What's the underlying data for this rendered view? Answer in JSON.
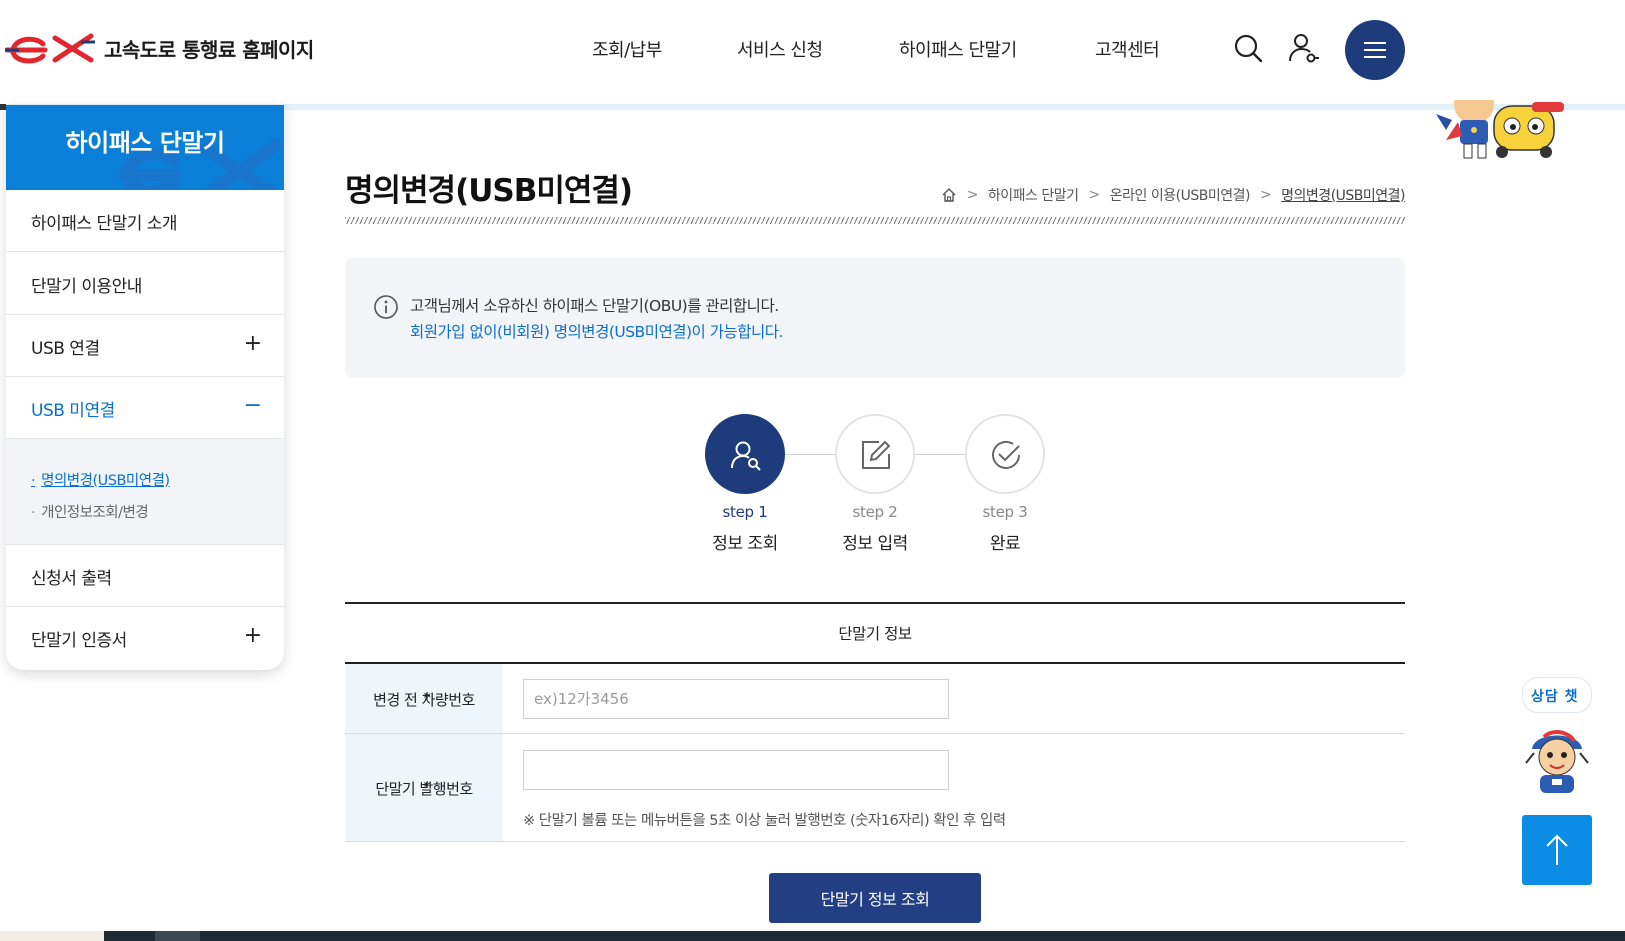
{
  "header": {
    "logo_text": "고속도로 통행료 홈페이지",
    "nav": [
      "조회/납부",
      "서비스 신청",
      "하이패스 단말기",
      "고객센터"
    ]
  },
  "sidebar": {
    "title": "하이패스 단말기",
    "items": [
      {
        "label": "하이패스 단말기 소개",
        "toggle": ""
      },
      {
        "label": "단말기 이용안내",
        "toggle": ""
      },
      {
        "label": "USB 연결",
        "toggle": "+"
      },
      {
        "label": "USB 미연결",
        "toggle": "−"
      },
      {
        "label": "신청서 출력",
        "toggle": ""
      },
      {
        "label": "단말기 인증서",
        "toggle": "+"
      }
    ],
    "sub_items": [
      "명의변경(USB미연결)",
      "개인정보조회/변경"
    ]
  },
  "page": {
    "title": "명의변경(USB미연결)",
    "breadcrumb": [
      "하이패스 단말기",
      "온라인 이용(USB미연결)",
      "명의변경(USB미연결)"
    ]
  },
  "notice": {
    "line1": "고객님께서 소유하신 하이패스 단말기(OBU)를 관리합니다.",
    "line2": "회원가입 없이(비회원) 명의변경(USB미연결)이 가능합니다."
  },
  "steps": [
    {
      "num": "step 1",
      "label": "정보 조회"
    },
    {
      "num": "step 2",
      "label": "정보 입력"
    },
    {
      "num": "step 3",
      "label": "완료"
    }
  ],
  "form": {
    "caption": "단말기 정보",
    "rows": [
      {
        "label": "변경 전 차량번호",
        "required": "*",
        "placeholder": "ex)12가3456",
        "value": ""
      },
      {
        "label": "단말기 발행번호",
        "required": "*",
        "placeholder": "",
        "value": "",
        "hint": "※ 단말기 볼륨 또는 메뉴버튼을 5초 이상 눌러 발행번호 (숫자16자리) 확인 후 입력"
      }
    ],
    "submit_label": "단말기 정보 조회"
  },
  "floating": {
    "chat_label": "상담 챗"
  },
  "colors": {
    "primary_navy": "#1e3c7c",
    "accent_blue": "#0b7ed8",
    "link_blue": "#0b6fcf",
    "logo_red": "#e3262e"
  }
}
